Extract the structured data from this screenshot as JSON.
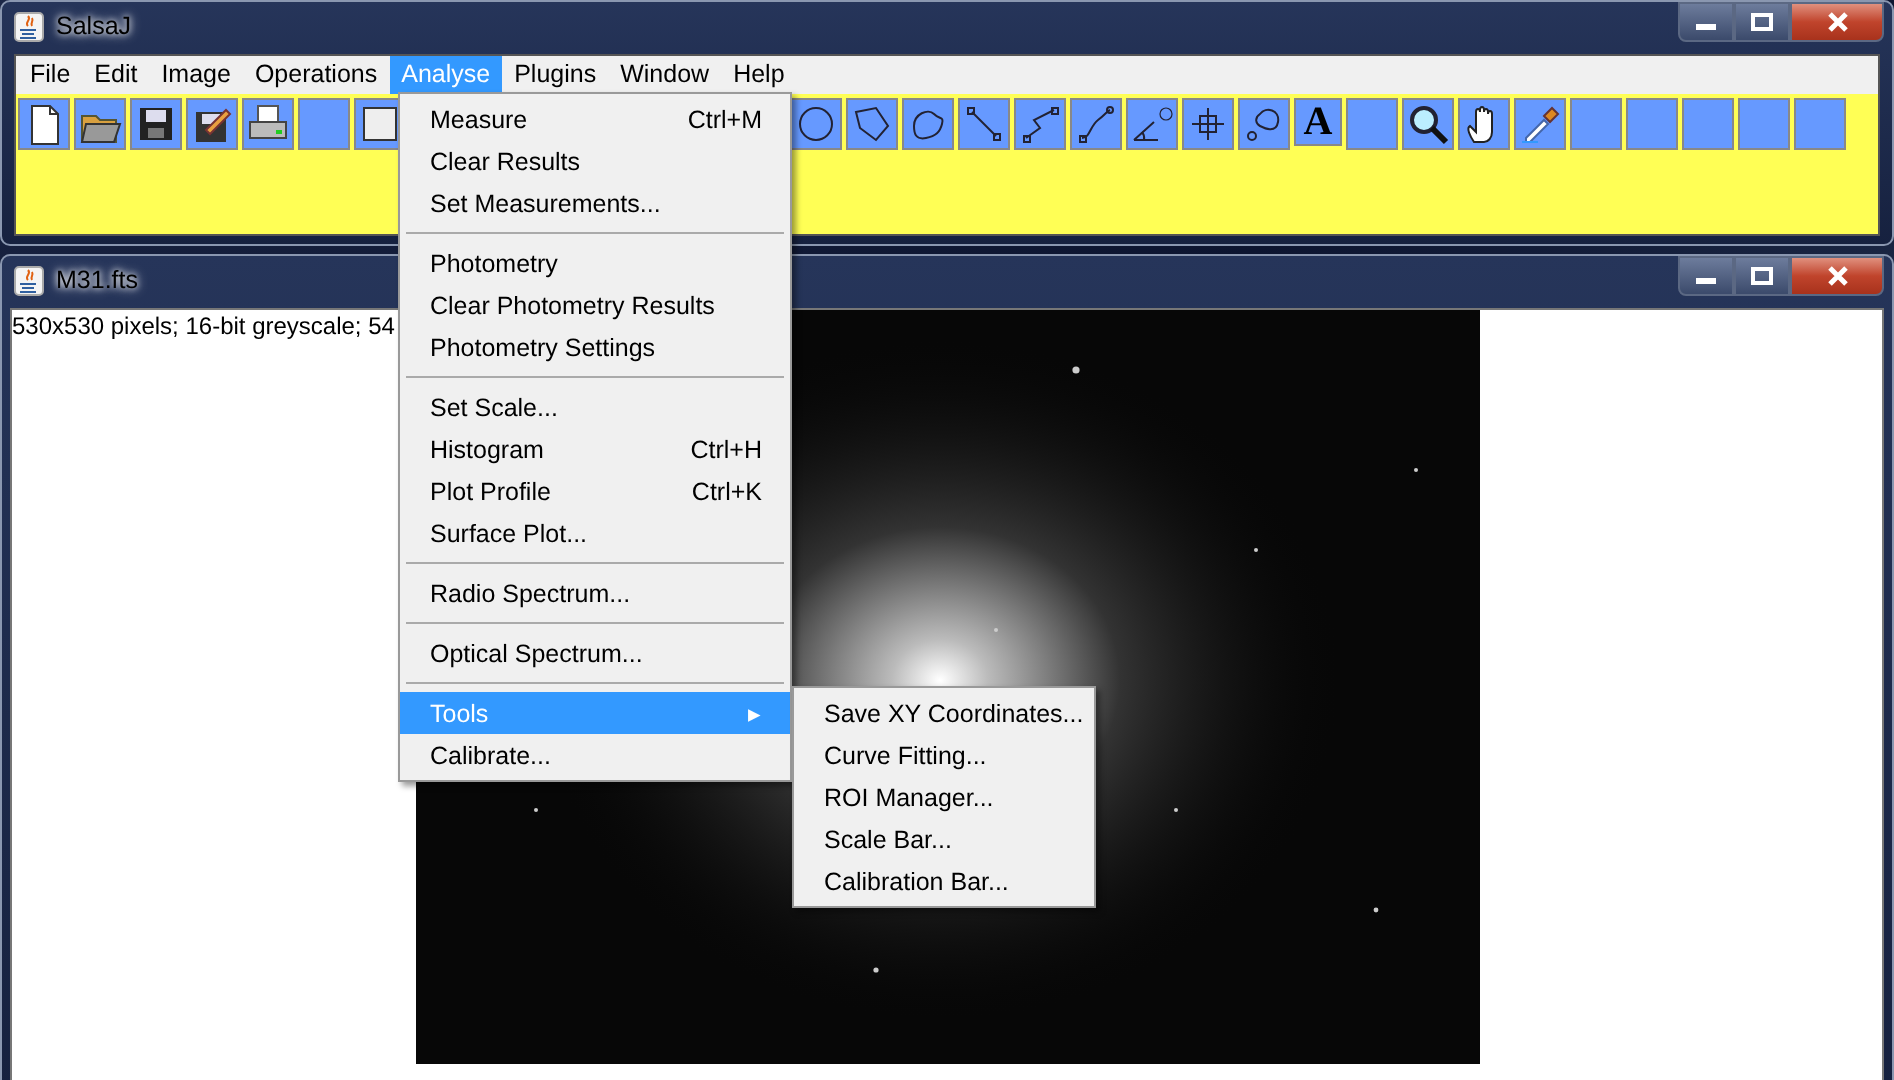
{
  "main_window": {
    "title": "SalsaJ"
  },
  "menu_bar": [
    {
      "label": "File",
      "selected": false
    },
    {
      "label": "Edit",
      "selected": false
    },
    {
      "label": "Image",
      "selected": false
    },
    {
      "label": "Operations",
      "selected": false
    },
    {
      "label": "Analyse",
      "selected": true
    },
    {
      "label": "Plugins",
      "selected": false
    },
    {
      "label": "Window",
      "selected": false
    },
    {
      "label": "Help",
      "selected": false
    }
  ],
  "toolbar_text_tool": {
    "label": "A"
  },
  "analyse_menu": [
    {
      "kind": "item",
      "label": "Measure",
      "shortcut": "Ctrl+M",
      "selected": false
    },
    {
      "kind": "item",
      "label": "Clear Results",
      "selected": false
    },
    {
      "kind": "item",
      "label": "Set Measurements...",
      "selected": false
    },
    {
      "kind": "separator"
    },
    {
      "kind": "item",
      "label": "Photometry",
      "selected": false
    },
    {
      "kind": "item",
      "label": "Clear Photometry Results",
      "selected": false
    },
    {
      "kind": "item",
      "label": "Photometry Settings",
      "selected": false
    },
    {
      "kind": "separator"
    },
    {
      "kind": "item",
      "label": "Set Scale...",
      "selected": false
    },
    {
      "kind": "item",
      "label": "Histogram",
      "shortcut": "Ctrl+H",
      "selected": false
    },
    {
      "kind": "item",
      "label": "Plot Profile",
      "shortcut": "Ctrl+K",
      "selected": false
    },
    {
      "kind": "item",
      "label": "Surface Plot...",
      "selected": false
    },
    {
      "kind": "separator"
    },
    {
      "kind": "item",
      "label": "Radio Spectrum...",
      "selected": false
    },
    {
      "kind": "separator"
    },
    {
      "kind": "item",
      "label": "Optical Spectrum...",
      "selected": false
    },
    {
      "kind": "separator"
    },
    {
      "kind": "submenu",
      "label": "Tools",
      "arrow": "▸",
      "selected": true
    },
    {
      "kind": "item",
      "label": "Calibrate...",
      "selected": false
    }
  ],
  "tools_submenu": [
    {
      "label": "Save XY Coordinates...",
      "selected": false
    },
    {
      "label": "Curve Fitting...",
      "selected": false
    },
    {
      "label": "ROI Manager...",
      "selected": false
    },
    {
      "label": "Scale Bar...",
      "selected": false
    },
    {
      "label": "Calibration Bar...",
      "selected": false
    }
  ],
  "image_window": {
    "title": "M31.fts",
    "info": "530x530 pixels; 16-bit greyscale; 54"
  }
}
